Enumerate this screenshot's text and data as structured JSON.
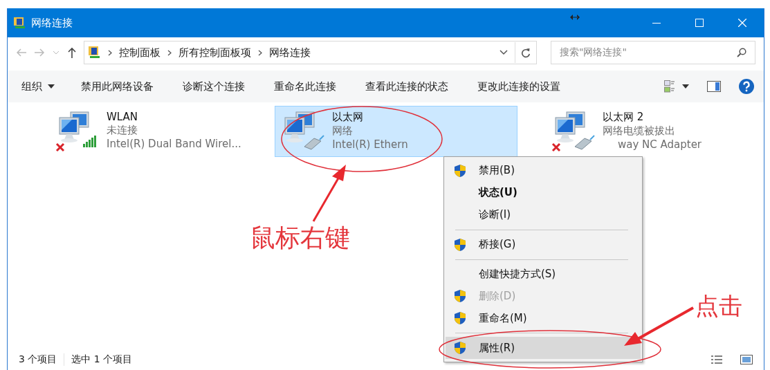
{
  "window": {
    "title": "网络连接"
  },
  "address_bar": {
    "breadcrumbs": [
      "控制面板",
      "所有控制面板项",
      "网络连接"
    ],
    "search_placeholder": "搜索\"网络连接\""
  },
  "toolbar": {
    "organize": "组织",
    "commands": [
      "禁用此网络设备",
      "诊断这个连接",
      "重命名此连接",
      "查看此连接的状态",
      "更改此连接的设置"
    ]
  },
  "adapters": [
    {
      "kind": "wireless",
      "name": "WLAN",
      "status": "未连接",
      "device": "Intel(R) Dual Band Wirel...",
      "disconnected": true,
      "selected": false
    },
    {
      "kind": "ethernet",
      "name": "以太网",
      "status": "网络",
      "device": "Intel(R) Ethern",
      "disconnected": false,
      "selected": true
    },
    {
      "kind": "ethernet",
      "name": "以太网 2",
      "status": "网络电缆被拔出",
      "device": "way NC Adapter",
      "disconnected": true,
      "selected": false
    }
  ],
  "context_menu": [
    {
      "kind": "item",
      "label": "禁用(B)",
      "shield": true,
      "bold": false,
      "disabled": false,
      "selected": false
    },
    {
      "kind": "item",
      "label": "状态(U)",
      "shield": false,
      "bold": true,
      "disabled": false,
      "selected": false
    },
    {
      "kind": "item",
      "label": "诊断(I)",
      "shield": false,
      "bold": false,
      "disabled": false,
      "selected": false
    },
    {
      "kind": "separator"
    },
    {
      "kind": "item",
      "label": "桥接(G)",
      "shield": true,
      "bold": false,
      "disabled": false,
      "selected": false
    },
    {
      "kind": "separator"
    },
    {
      "kind": "item",
      "label": "创建快捷方式(S)",
      "shield": false,
      "bold": false,
      "disabled": false,
      "selected": false
    },
    {
      "kind": "item",
      "label": "删除(D)",
      "shield": true,
      "bold": false,
      "disabled": true,
      "selected": false
    },
    {
      "kind": "item",
      "label": "重命名(M)",
      "shield": true,
      "bold": false,
      "disabled": false,
      "selected": false
    },
    {
      "kind": "separator"
    },
    {
      "kind": "item",
      "label": "属性(R)",
      "shield": true,
      "bold": false,
      "disabled": false,
      "selected": true
    }
  ],
  "status_bar": {
    "count": "3 个项目",
    "selection": "选中 1 个项目"
  },
  "annotations": [
    {
      "text": "鼠标右键"
    },
    {
      "text": "点击"
    }
  ]
}
